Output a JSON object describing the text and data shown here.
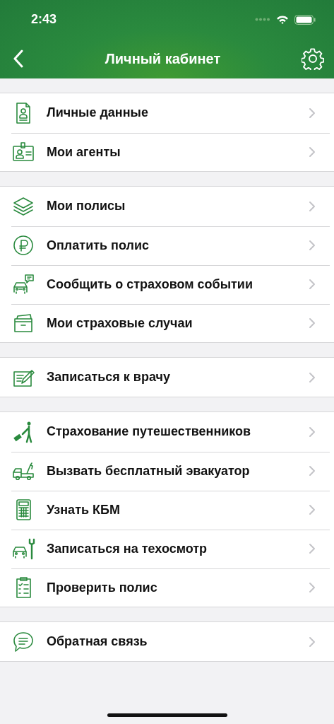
{
  "status_bar": {
    "time": "2:43"
  },
  "nav": {
    "title": "Личный кабинет"
  },
  "groups": [
    {
      "items": [
        {
          "label": "Личные данные"
        },
        {
          "label": "Мои агенты"
        }
      ]
    },
    {
      "items": [
        {
          "label": "Мои полисы"
        },
        {
          "label": "Оплатить полис"
        },
        {
          "label": "Сообщить о страховом событии"
        },
        {
          "label": "Мои страховые случаи"
        }
      ]
    },
    {
      "items": [
        {
          "label": "Записаться к врачу"
        }
      ]
    },
    {
      "items": [
        {
          "label": "Страхование путешественников"
        },
        {
          "label": "Вызвать бесплатный эвакуатор"
        },
        {
          "label": "Узнать КБМ"
        },
        {
          "label": "Записаться на техосмотр"
        },
        {
          "label": "Проверить полис"
        }
      ]
    },
    {
      "items": [
        {
          "label": "Обратная связь"
        }
      ]
    }
  ]
}
